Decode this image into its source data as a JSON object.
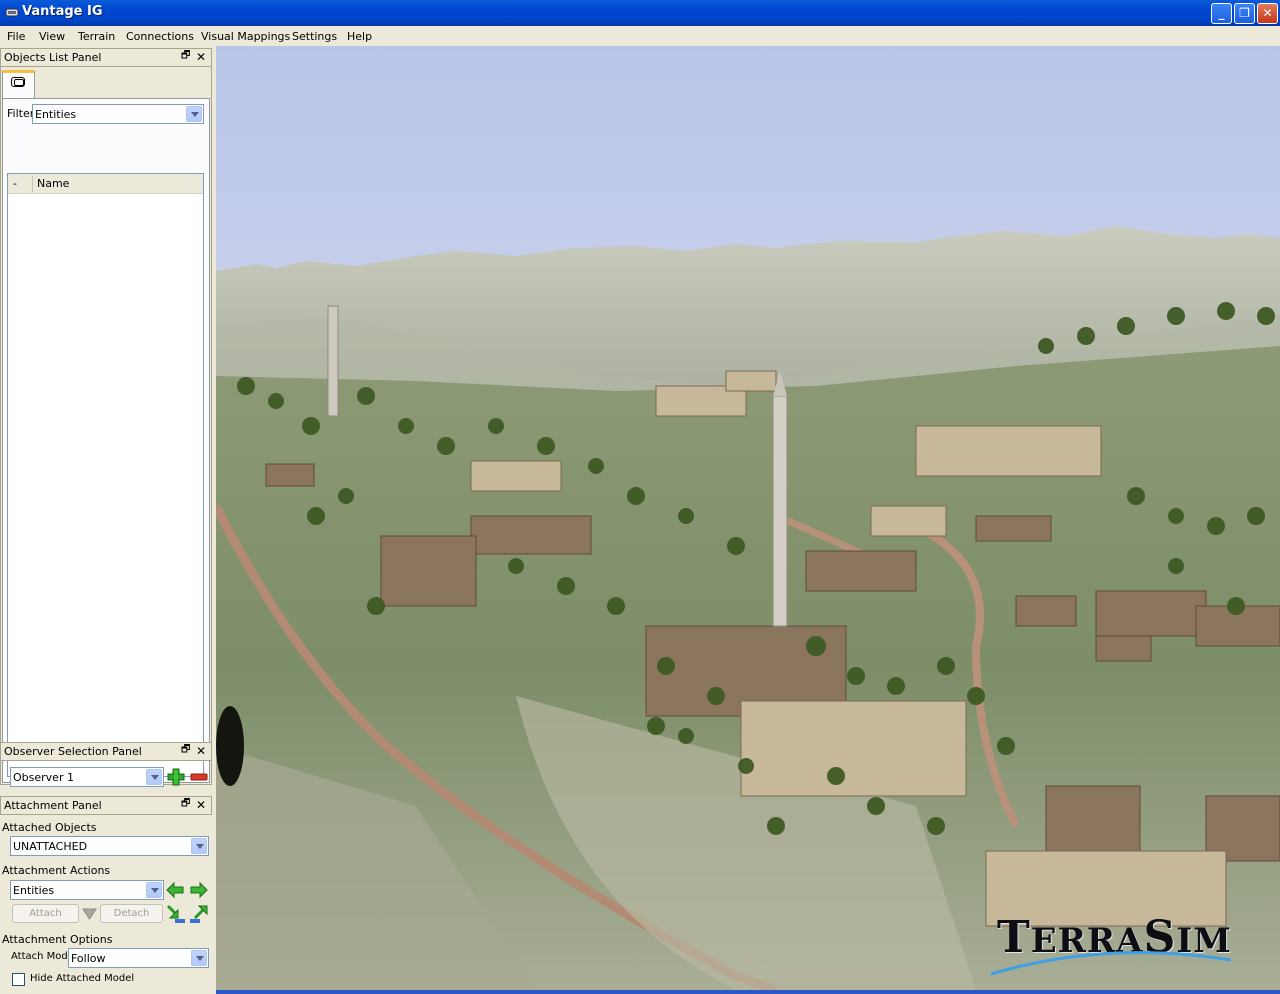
{
  "window": {
    "title": "Vantage IG"
  },
  "menu": [
    "File",
    "View",
    "Terrain",
    "Connections",
    "Visual Mappings",
    "Settings",
    "Help"
  ],
  "objects_panel": {
    "title": "Objects List Panel",
    "filter_label": "Filter",
    "filter_value": "Entities",
    "columns": [
      "-",
      "Name"
    ]
  },
  "observer_panel": {
    "title": "Observer Selection Panel",
    "observer_value": "Observer 1"
  },
  "attachment_panel": {
    "title": "Attachment Panel",
    "attached_objects_label": "Attached Objects",
    "attached_objects_value": "UNATTACHED",
    "actions_label": "Attachment Actions",
    "actions_value": "Entities",
    "attach_label": "Attach",
    "detach_label": "Detach",
    "options_label": "Attachment Options",
    "attach_mode_label": "Attach Mode",
    "attach_mode_value": "Follow",
    "hide_model_label": "Hide Attached Model",
    "hide_model_checked": false
  },
  "logo": {
    "text_big": "T",
    "text_rest": "ERRA",
    "text_big2": "S",
    "text_rest2": "IM"
  },
  "colors": {
    "titlebar": "#0047d0",
    "panel_bg": "#ece9d8",
    "sky": "#c9d2ef"
  }
}
